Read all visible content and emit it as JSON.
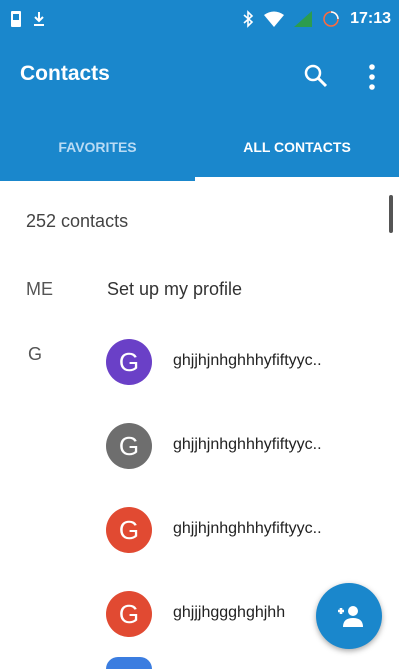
{
  "status_bar": {
    "time": "17:13"
  },
  "app_bar": {
    "title": "Contacts"
  },
  "tabs": [
    {
      "label": "FAVORITES"
    },
    {
      "label": "ALL CONTACTS"
    }
  ],
  "list": {
    "count_text": "252 contacts",
    "me": {
      "label": "ME",
      "text": "Set up my profile"
    },
    "sections": [
      {
        "letter": "G",
        "contacts": [
          {
            "initial": "G",
            "name": "ghjjhjnhghhhyfiftyyc..",
            "color": "#6a40c7"
          },
          {
            "initial": "G",
            "name": "ghjjhjnhghhhyfiftyyc..",
            "color": "#6e6e6e"
          },
          {
            "initial": "G",
            "name": "ghjjhjnhghhhyfiftyyc..",
            "color": "#e14a32"
          },
          {
            "initial": "G",
            "name": "ghjjjhggghghjhh",
            "color": "#e14a32"
          }
        ]
      }
    ]
  },
  "colors": {
    "primary": "#1a87cc"
  }
}
